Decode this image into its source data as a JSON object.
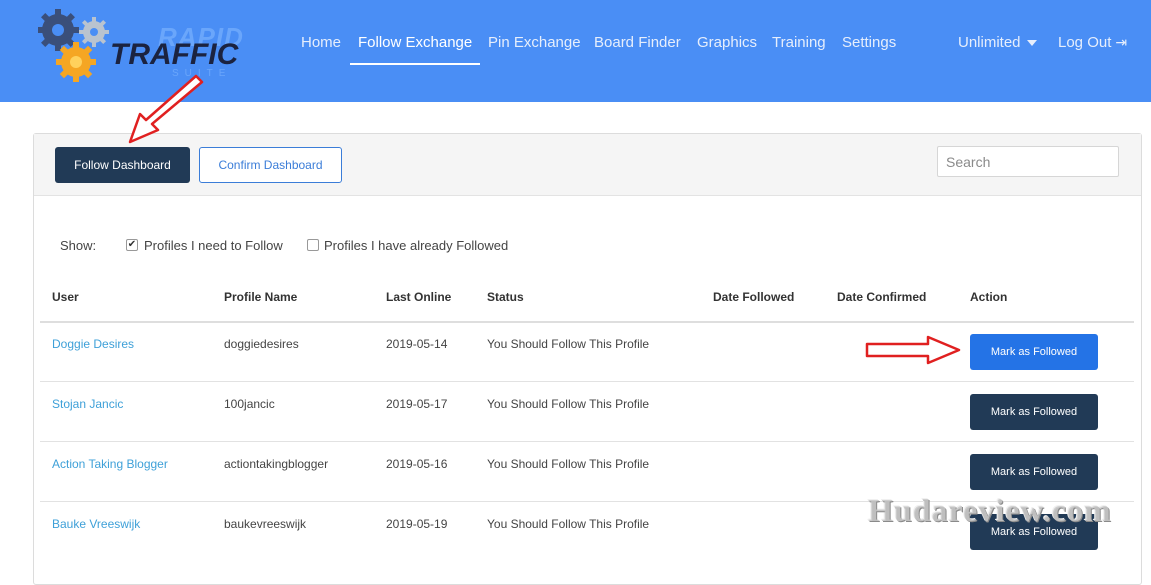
{
  "header": {
    "logo": {
      "word1": "RAPID",
      "word2": "TRAFFIC",
      "word3": "SUITE"
    },
    "nav": [
      {
        "label": "Home"
      },
      {
        "label": "Follow Exchange",
        "active": true
      },
      {
        "label": "Pin Exchange"
      },
      {
        "label": "Board Finder"
      },
      {
        "label": "Graphics"
      },
      {
        "label": "Training"
      },
      {
        "label": "Settings"
      }
    ],
    "plan_label": "Unlimited",
    "logout_label": "Log Out"
  },
  "panel": {
    "follow_dashboard_label": "Follow Dashboard",
    "confirm_dashboard_label": "Confirm Dashboard",
    "search_placeholder": "Search"
  },
  "filters": {
    "show_label": "Show:",
    "need_to_follow": {
      "label": "Profiles I need to Follow",
      "checked": true
    },
    "already_followed": {
      "label": "Profiles I have already Followed",
      "checked": false
    }
  },
  "table": {
    "columns": [
      "User",
      "Profile Name",
      "Last Online",
      "Status",
      "Date Followed",
      "Date Confirmed",
      "Action"
    ],
    "rows": [
      {
        "user": "Doggie Desires",
        "profile": "doggiedesires",
        "last_online": "2019-05-14",
        "status": "You Should Follow This Profile",
        "date_followed": "",
        "date_confirmed": "",
        "action": "Mark as Followed"
      },
      {
        "user": "Stojan Jancic",
        "profile": "100jancic",
        "last_online": "2019-05-17",
        "status": "You Should Follow This Profile",
        "date_followed": "",
        "date_confirmed": "",
        "action": "Mark as Followed"
      },
      {
        "user": "Action Taking Blogger",
        "profile": "actiontakingblogger",
        "last_online": "2019-05-16",
        "status": "You Should Follow This Profile",
        "date_followed": "",
        "date_confirmed": "",
        "action": "Mark as Followed"
      },
      {
        "user": "Bauke Vreeswijk",
        "profile": "baukevreeswijk",
        "last_online": "2019-05-19",
        "status": "You Should Follow This Profile",
        "date_followed": "",
        "date_confirmed": "",
        "action": "Mark as Followed"
      }
    ]
  },
  "watermark": "Hudareview.com",
  "colors": {
    "header_bg": "#4a8ef5",
    "primary_button": "#2473e6",
    "dark_button": "#213a56",
    "link": "#3ea0d8",
    "annotation_arrow": "#e02020"
  },
  "icons": [
    "gear-icon",
    "logout-icon",
    "checkbox-icon",
    "caret-down-icon",
    "red-arrow-icon"
  ]
}
